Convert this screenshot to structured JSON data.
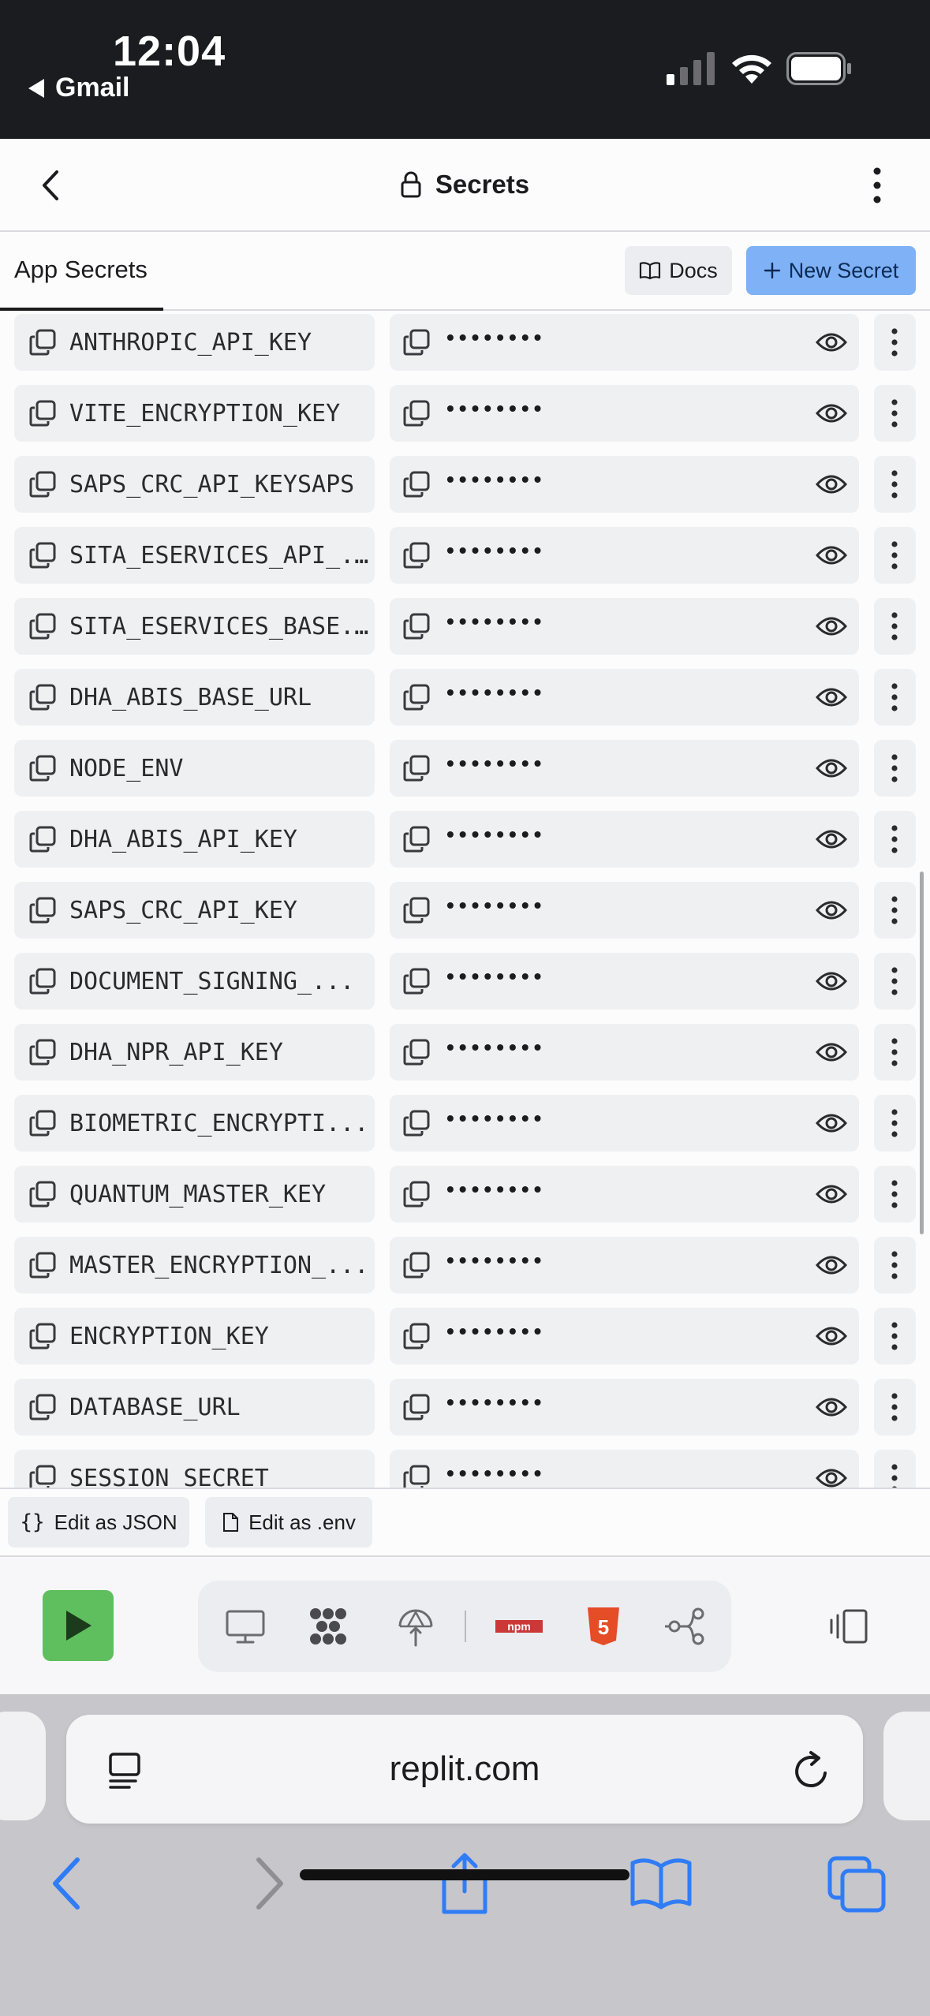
{
  "status_bar": {
    "time": "12:04",
    "back_app": "Gmail"
  },
  "header": {
    "title": "Secrets"
  },
  "tabs": {
    "active": "App Secrets",
    "docs_label": "Docs",
    "new_secret_label": "New Secret"
  },
  "secrets": [
    {
      "key": "ANTHROPIC_API_KEY",
      "value": "••••••••"
    },
    {
      "key": "VITE_ENCRYPTION_KEY",
      "value": "••••••••"
    },
    {
      "key": "SAPS_CRC_API_KEYSAPS",
      "value": "••••••••"
    },
    {
      "key": "SITA_ESERVICES_API_...",
      "value": "••••••••"
    },
    {
      "key": "SITA_ESERVICES_BASE...",
      "value": "••••••••"
    },
    {
      "key": "DHA_ABIS_BASE_URL",
      "value": "••••••••"
    },
    {
      "key": "NODE_ENV",
      "value": "••••••••"
    },
    {
      "key": "DHA_ABIS_API_KEY",
      "value": "••••••••"
    },
    {
      "key": "SAPS_CRC_API_KEY",
      "value": "••••••••"
    },
    {
      "key": "DOCUMENT_SIGNING_...",
      "value": "••••••••"
    },
    {
      "key": "DHA_NPR_API_KEY",
      "value": "••••••••"
    },
    {
      "key": "BIOMETRIC_ENCRYPTI...",
      "value": "••••••••"
    },
    {
      "key": "QUANTUM_MASTER_KEY",
      "value": "••••••••"
    },
    {
      "key": "MASTER_ENCRYPTION_...",
      "value": "••••••••"
    },
    {
      "key": "ENCRYPTION_KEY",
      "value": "••••••••"
    },
    {
      "key": "DATABASE_URL",
      "value": "••••••••"
    },
    {
      "key": "SESSION_SECRET",
      "value": "••••••••"
    }
  ],
  "edit_actions": {
    "json_label": "Edit as JSON",
    "env_label": "Edit as .env"
  },
  "toolbar": {
    "icons": [
      "run-icon",
      "monitor-icon",
      "dots-grid-icon",
      "deploy-icon",
      "npm-icon",
      "html5-icon",
      "git-branch-icon",
      "split-view-icon"
    ],
    "accent_run": "#5fbf5f"
  },
  "browser": {
    "url": "replit.com"
  }
}
